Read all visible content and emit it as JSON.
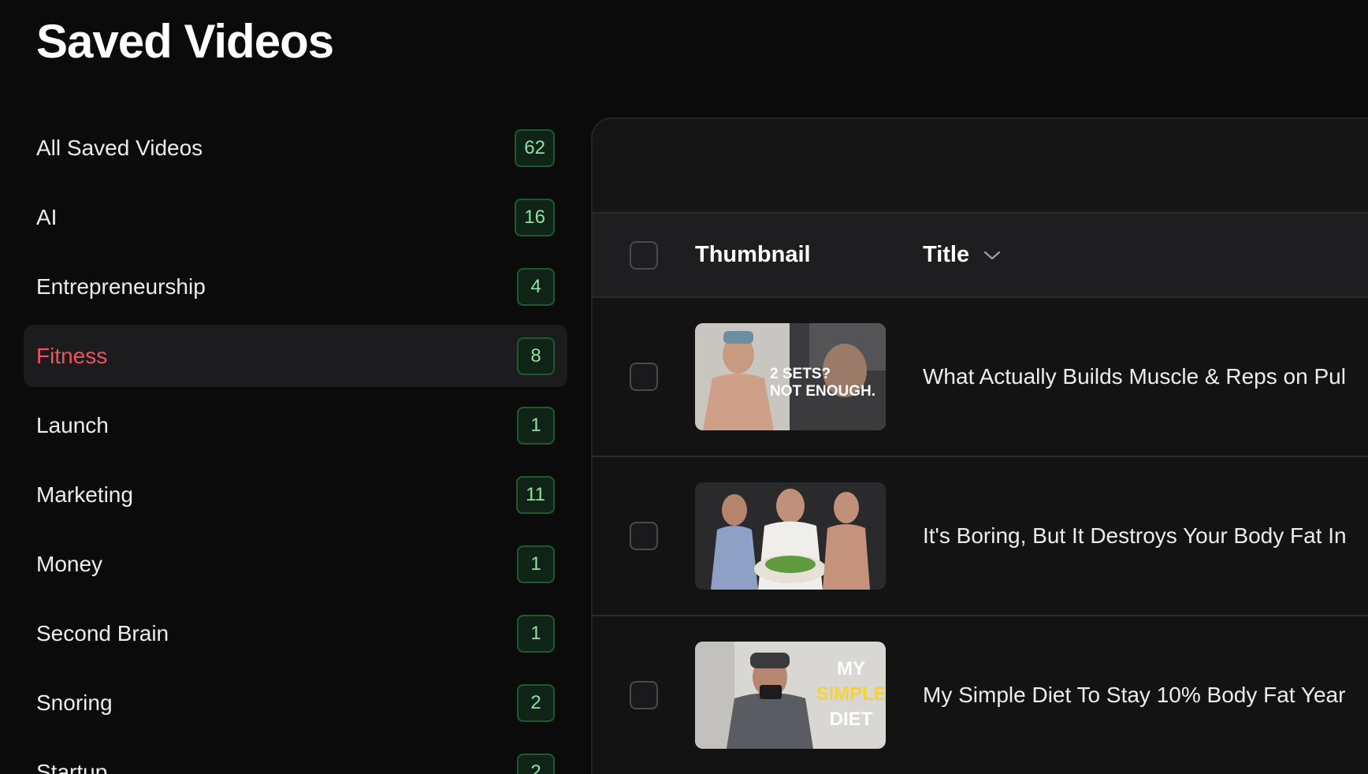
{
  "page": {
    "title": "Saved Videos"
  },
  "sidebar": {
    "items": [
      {
        "label": "All Saved Videos",
        "count": "62",
        "active": false
      },
      {
        "label": "AI",
        "count": "16",
        "active": false
      },
      {
        "label": "Entrepreneurship",
        "count": "4",
        "active": false
      },
      {
        "label": "Fitness",
        "count": "8",
        "active": true
      },
      {
        "label": "Launch",
        "count": "1",
        "active": false
      },
      {
        "label": "Marketing",
        "count": "11",
        "active": false
      },
      {
        "label": "Money",
        "count": "1",
        "active": false
      },
      {
        "label": "Second Brain",
        "count": "1",
        "active": false
      },
      {
        "label": "Snoring",
        "count": "2",
        "active": false
      },
      {
        "label": "Startup",
        "count": "2",
        "active": false
      }
    ]
  },
  "table": {
    "columns": {
      "thumbnail": "Thumbnail",
      "title": "Title"
    },
    "sort_icon": "chevron-down-icon",
    "rows": [
      {
        "title": "What Actually Builds Muscle & Reps on Pul",
        "thumb_text": [
          "2 SETS?",
          "NOT ENOUGH."
        ]
      },
      {
        "title": "It's Boring, But It Destroys Your Body Fat In",
        "thumb_text": []
      },
      {
        "title": "My Simple Diet To Stay 10% Body Fat Year",
        "thumb_text": [
          "MY",
          "SIMPLE",
          "DIET"
        ]
      }
    ]
  },
  "colors": {
    "accent_active": "#f0525f",
    "badge_text": "#8fe0a1",
    "badge_border": "#1f5a2f"
  }
}
